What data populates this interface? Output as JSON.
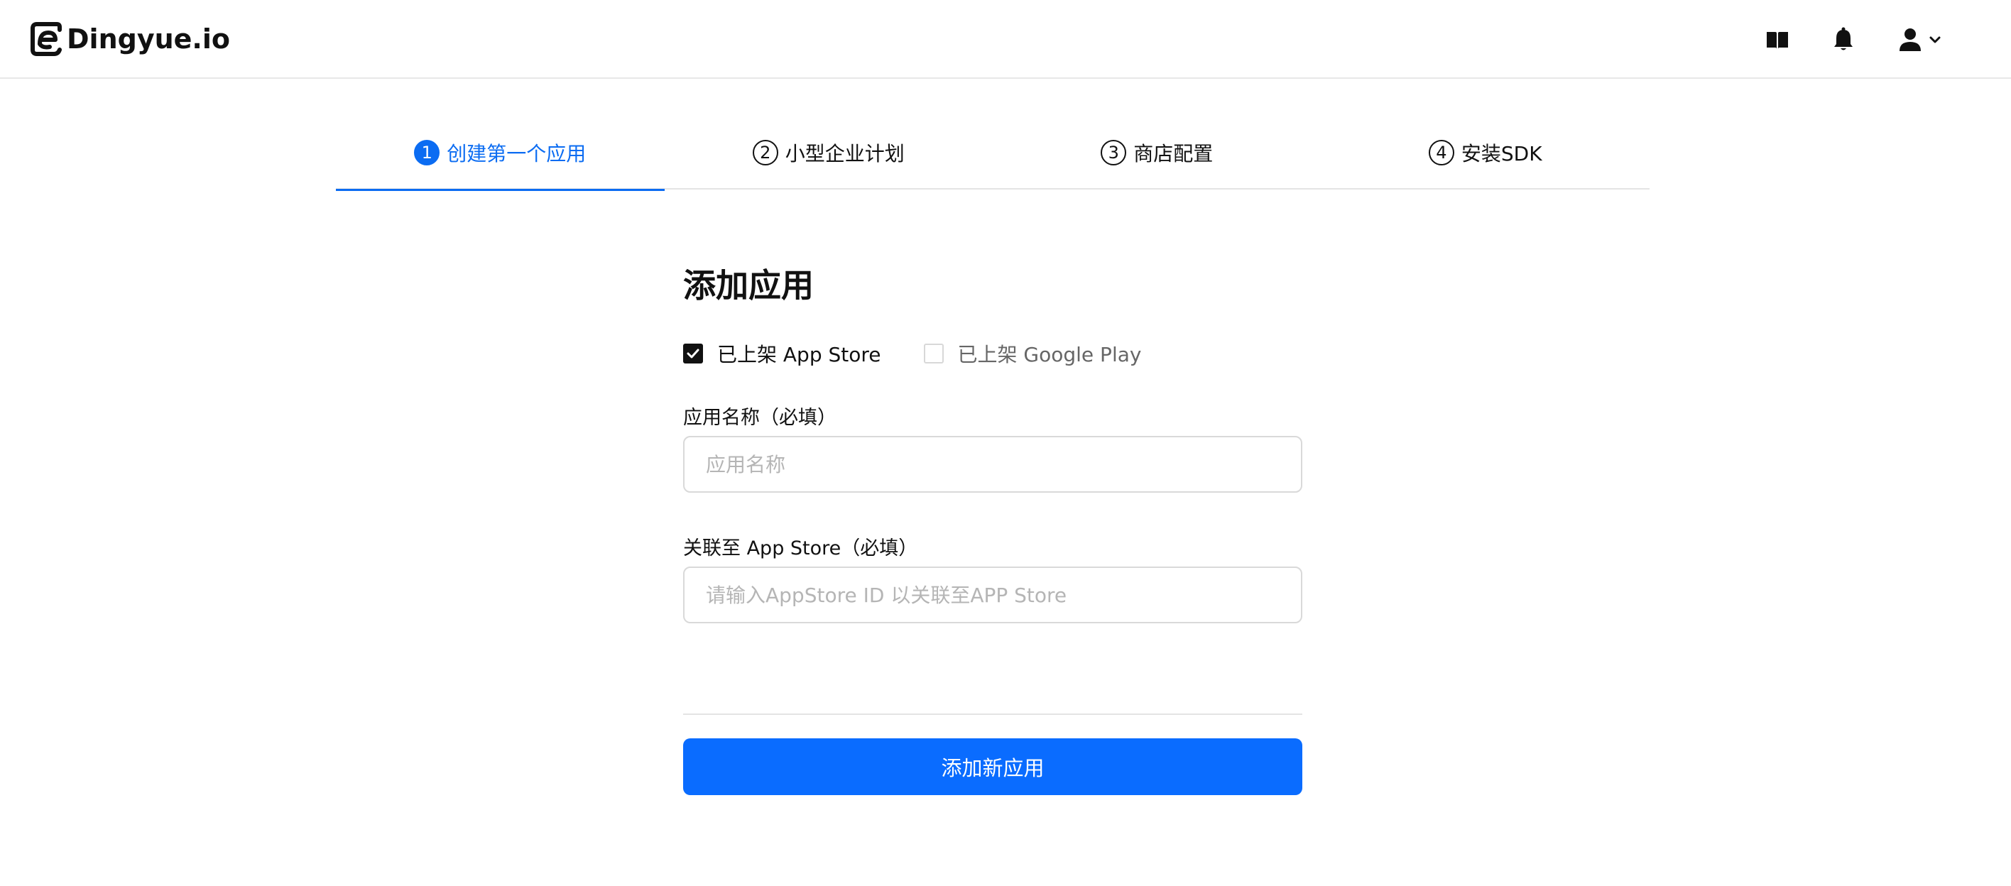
{
  "header": {
    "logo_text": "Dingyue.io",
    "icons": [
      "book-icon",
      "bell-icon",
      "user-icon",
      "chevron-down-icon"
    ]
  },
  "steps": [
    {
      "num": "1",
      "label": "创建第一个应用",
      "active": true
    },
    {
      "num": "2",
      "label": "小型企业计划",
      "active": false
    },
    {
      "num": "3",
      "label": "商店配置",
      "active": false
    },
    {
      "num": "4",
      "label": "安装SDK",
      "active": false
    }
  ],
  "form": {
    "title": "添加应用",
    "checkbox_app_store": {
      "label": "已上架 App Store",
      "checked": true
    },
    "checkbox_google_play": {
      "label": "已上架 Google Play",
      "checked": false
    },
    "app_name": {
      "label": "应用名称（必填）",
      "placeholder": "应用名称",
      "value": ""
    },
    "app_store_link": {
      "label": "关联至 App Store（必填）",
      "placeholder": "请输入AppStore ID 以关联至APP Store",
      "value": ""
    },
    "submit_label": "添加新应用"
  },
  "colors": {
    "accent": "#0a6cff",
    "active_step": "#0b6cf2",
    "text": "#111111",
    "border": "#d9d9d9"
  }
}
